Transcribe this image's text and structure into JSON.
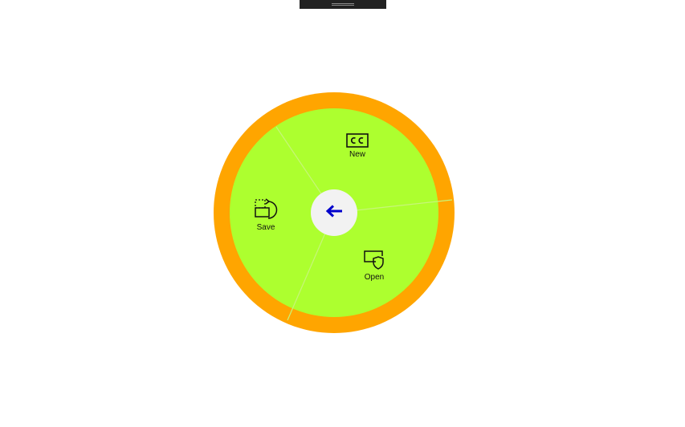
{
  "colors": {
    "outer_ring": "#FFA500",
    "wheel_fill": "#ADFF2F",
    "divider": "#C7F57A",
    "center_button": "#F2F2F2",
    "back_arrow": "#0000CC",
    "drag_handle": "#222222"
  },
  "radial_menu": {
    "items": [
      {
        "label": "New",
        "icon": "closed-caption-icon"
      },
      {
        "label": "Save",
        "icon": "rotate-crop-icon"
      },
      {
        "label": "Open",
        "icon": "shield-monitor-icon"
      }
    ],
    "center": {
      "icon": "back-arrow-icon"
    }
  }
}
